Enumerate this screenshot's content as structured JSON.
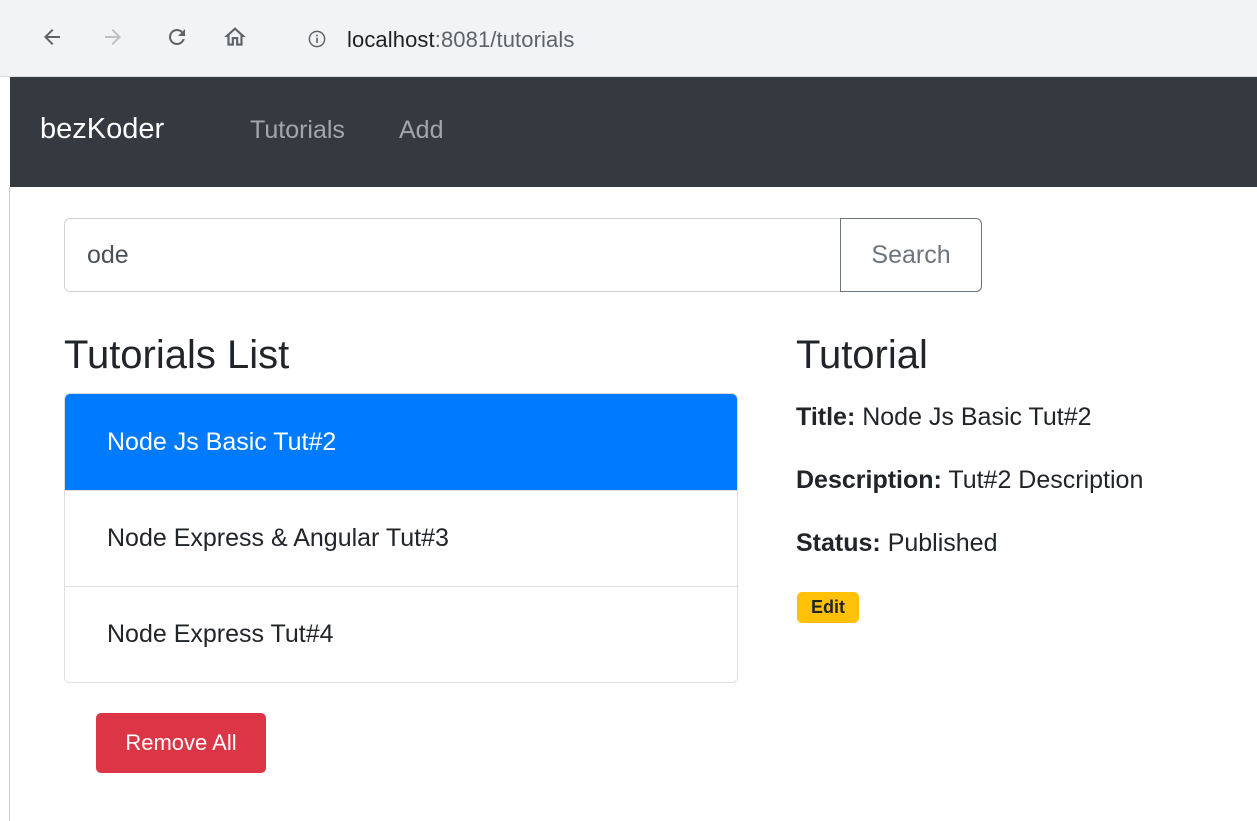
{
  "browser": {
    "url_host": "localhost",
    "url_rest": ":8081/tutorials"
  },
  "navbar": {
    "brand": "bezKoder",
    "links": [
      "Tutorials",
      "Add"
    ]
  },
  "search": {
    "value": "ode",
    "button_label": "Search"
  },
  "list": {
    "title": "Tutorials List",
    "items": [
      "Node Js Basic Tut#2",
      "Node Express & Angular Tut#3",
      "Node Express Tut#4"
    ],
    "active_index": 0,
    "remove_all_label": "Remove All"
  },
  "detail": {
    "heading": "Tutorial",
    "title_label": "Title:",
    "title_value": "Node Js Basic Tut#2",
    "description_label": "Description:",
    "description_value": "Tut#2 Description",
    "status_label": "Status:",
    "status_value": "Published",
    "edit_label": "Edit"
  },
  "colors": {
    "navbar_bg": "#343a40",
    "active_item": "#007bff",
    "danger": "#dc3545",
    "warning": "#ffc107"
  },
  "icons": [
    "back-arrow-icon",
    "forward-arrow-icon",
    "reload-icon",
    "home-icon",
    "info-icon"
  ]
}
